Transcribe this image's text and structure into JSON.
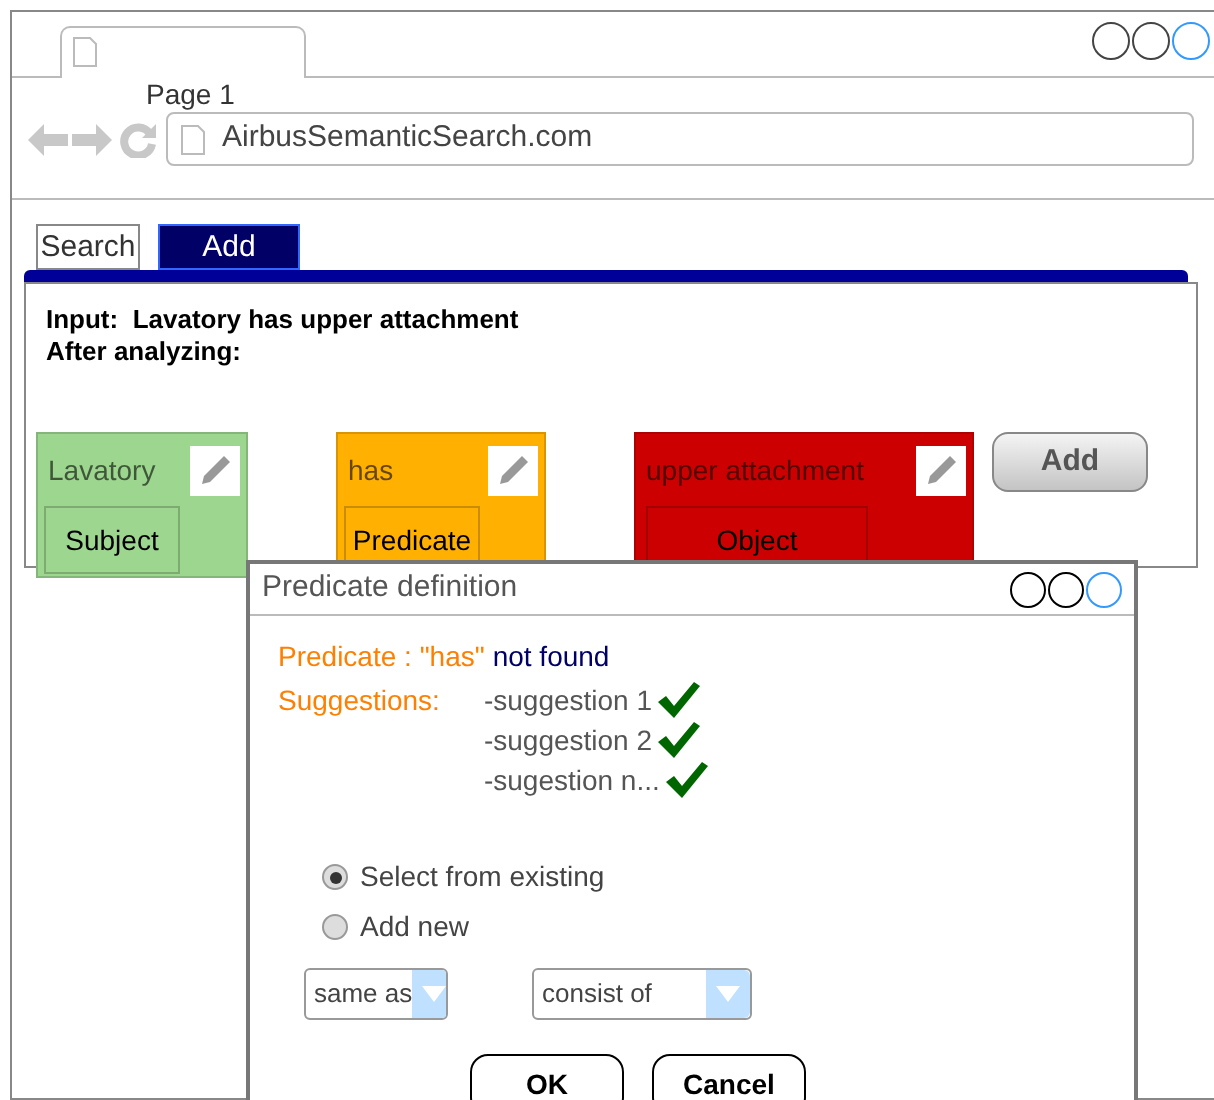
{
  "browser": {
    "tab_title": "Page 1",
    "url": "AirbusSemanticSearch.com"
  },
  "tabs": [
    {
      "label": "Search",
      "selected": false
    },
    {
      "label": "Add",
      "selected": true
    }
  ],
  "input_line": "Input:  Lavatory has upper attachment",
  "analysis_label": "After analyzing:",
  "terms": [
    {
      "value": "Lavatory",
      "role": "Subject",
      "color": "#9dd68f"
    },
    {
      "value": "has",
      "role": "Predicate",
      "color": "#ffb000"
    },
    {
      "value": "upper attachment",
      "role": "Object",
      "color": "#cc0000"
    }
  ],
  "add_button": {
    "label": "Add",
    "disabled": true
  },
  "dialog": {
    "title": "Predicate definition",
    "predicate_label": "Predicate : \"has\"",
    "status": "not found",
    "suggestions_label": "Suggestions:",
    "suggestions": [
      {
        "text": "-suggestion 1",
        "checked": true
      },
      {
        "text": "-suggestion 2",
        "checked": true
      },
      {
        "text": "-sugestion n...",
        "checked": true
      }
    ],
    "options": [
      {
        "label": "Select from existing",
        "selected": true
      },
      {
        "label": "Add new",
        "selected": false
      }
    ],
    "dropdowns": [
      {
        "value": "same as"
      },
      {
        "value": "consist of"
      }
    ],
    "buttons": [
      "OK",
      "Cancel"
    ]
  }
}
